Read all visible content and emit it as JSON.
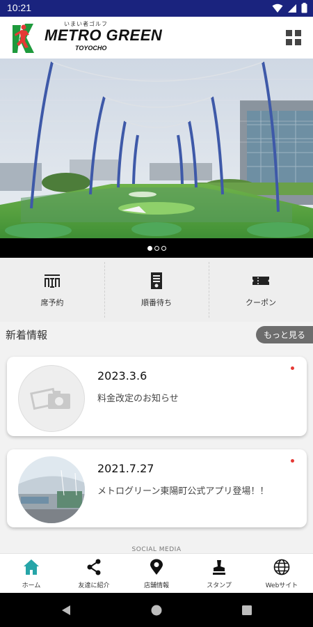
{
  "status_bar": {
    "time": "10:21"
  },
  "header": {
    "logo_sub": "いまい者ゴルフ",
    "logo_title": "METRO GREEN",
    "logo_city": "TOYOCHO",
    "menu_icon": "grid-menu-icon"
  },
  "hero": {
    "slides": 3,
    "active_slide": 1
  },
  "shortcuts": [
    {
      "label": "席予約",
      "icon": "seat-reservation-icon"
    },
    {
      "label": "順番待ち",
      "icon": "waitlist-icon"
    },
    {
      "label": "クーポン",
      "icon": "coupon-icon"
    }
  ],
  "news": {
    "title": "新着情報",
    "more_label": "もっと見る",
    "items": [
      {
        "date": "2023.3.6",
        "text": "料金改定のお知らせ",
        "unread": true
      },
      {
        "date": "2021.7.27",
        "text": "メトログリーン東陽町公式アプリ登場！！",
        "unread": true
      }
    ]
  },
  "social_label": "SOCIAL MEDIA",
  "bottom_nav": [
    {
      "label": "ホーム",
      "icon": "home-icon",
      "active": true
    },
    {
      "label": "友達に紹介",
      "icon": "share-icon"
    },
    {
      "label": "店舗情報",
      "icon": "location-pin-icon"
    },
    {
      "label": "スタンプ",
      "icon": "stamp-icon"
    },
    {
      "label": "Webサイト",
      "icon": "globe-icon"
    }
  ],
  "colors": {
    "status_bar": "#1a237e",
    "accent": "#26a5a8",
    "unread": "#e53935",
    "brand_green": "#1e9a3c",
    "brand_red": "#e53935"
  }
}
